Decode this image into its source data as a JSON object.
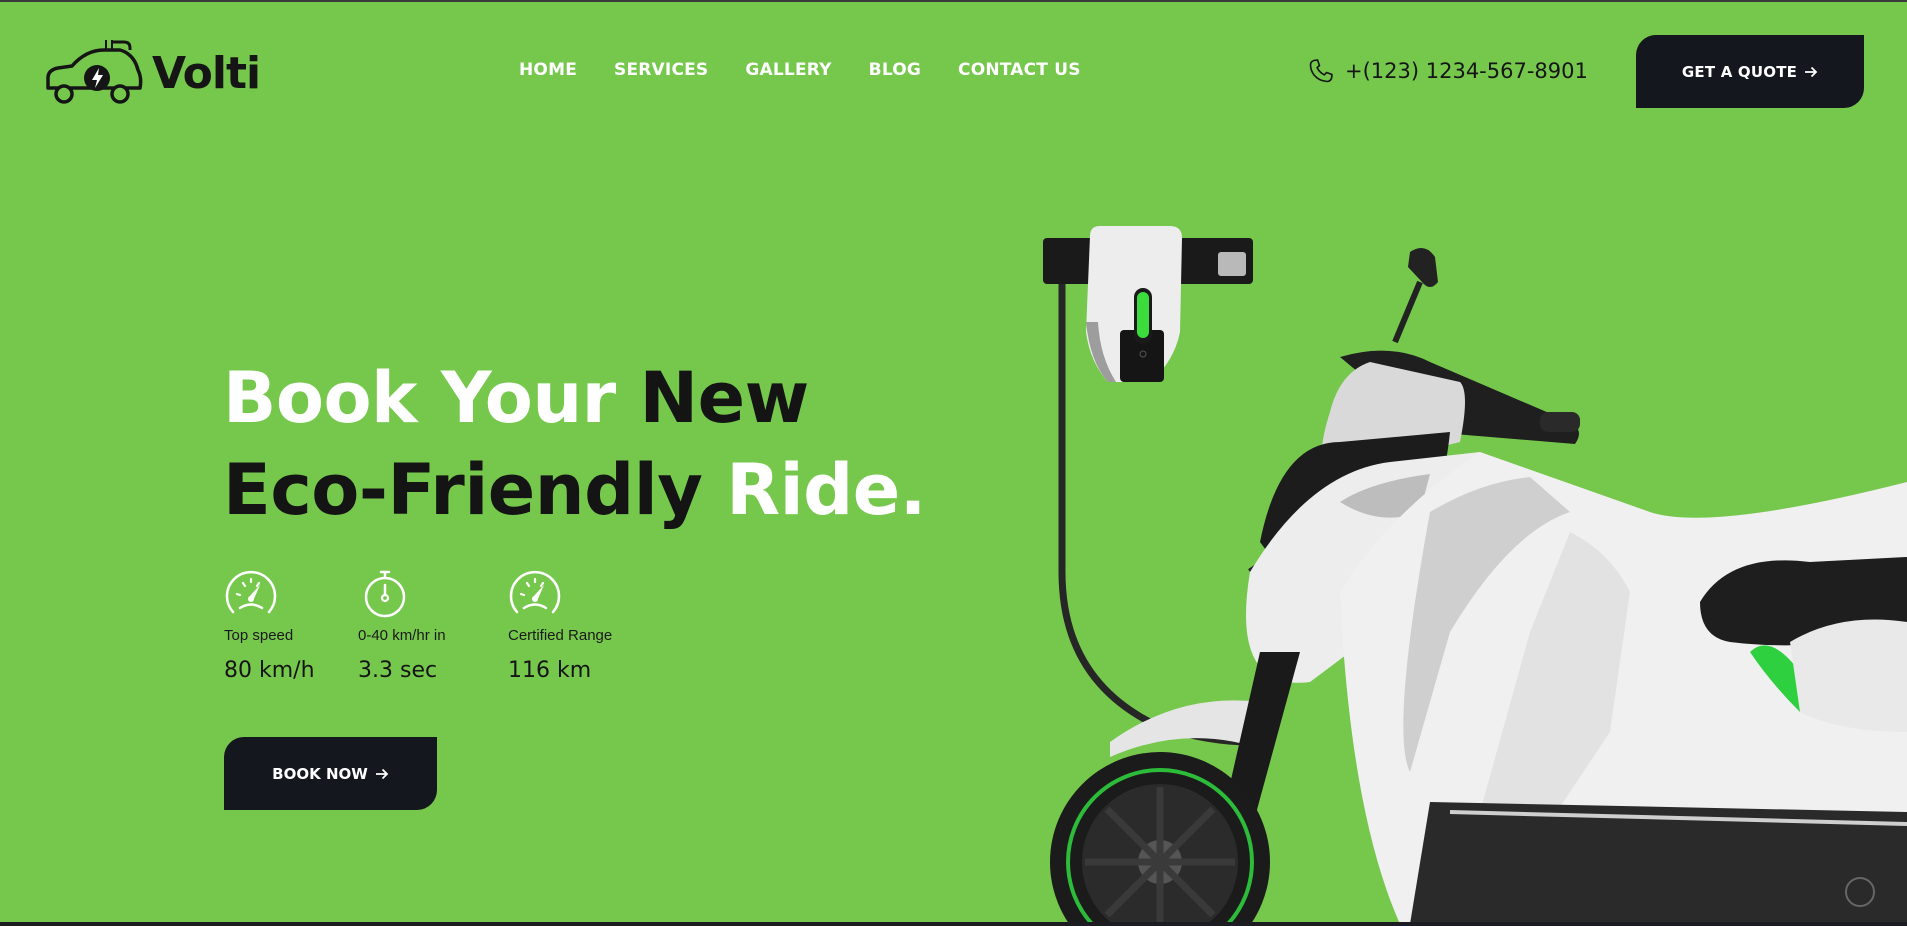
{
  "brand": {
    "name": "Volti"
  },
  "nav": {
    "items": [
      {
        "label": "HOME"
      },
      {
        "label": "SERVICES"
      },
      {
        "label": "GALLERY"
      },
      {
        "label": "BLOG"
      },
      {
        "label": "CONTACT US"
      }
    ]
  },
  "contact": {
    "phone": "+(123) 1234-567-8901"
  },
  "header": {
    "quote_label": "GET A QUOTE"
  },
  "hero": {
    "title_line1_part1": "Book Your ",
    "title_line1_part2": "New",
    "title_line2_part1": "Eco-Friendly ",
    "title_line2_part2": "Ride.",
    "stats": [
      {
        "icon": "speedometer-icon",
        "label": "Top speed",
        "value": "80 km/h"
      },
      {
        "icon": "stopwatch-icon",
        "label": "0-40 km/hr in",
        "value": "3.3 sec"
      },
      {
        "icon": "speedometer-icon",
        "label": "Certified Range",
        "value": "116 km"
      }
    ],
    "cta_label": "BOOK NOW"
  },
  "colors": {
    "background": "#76c84d",
    "dark": "#15171f",
    "text_white": "#ffffff",
    "text_dark": "#141414"
  }
}
